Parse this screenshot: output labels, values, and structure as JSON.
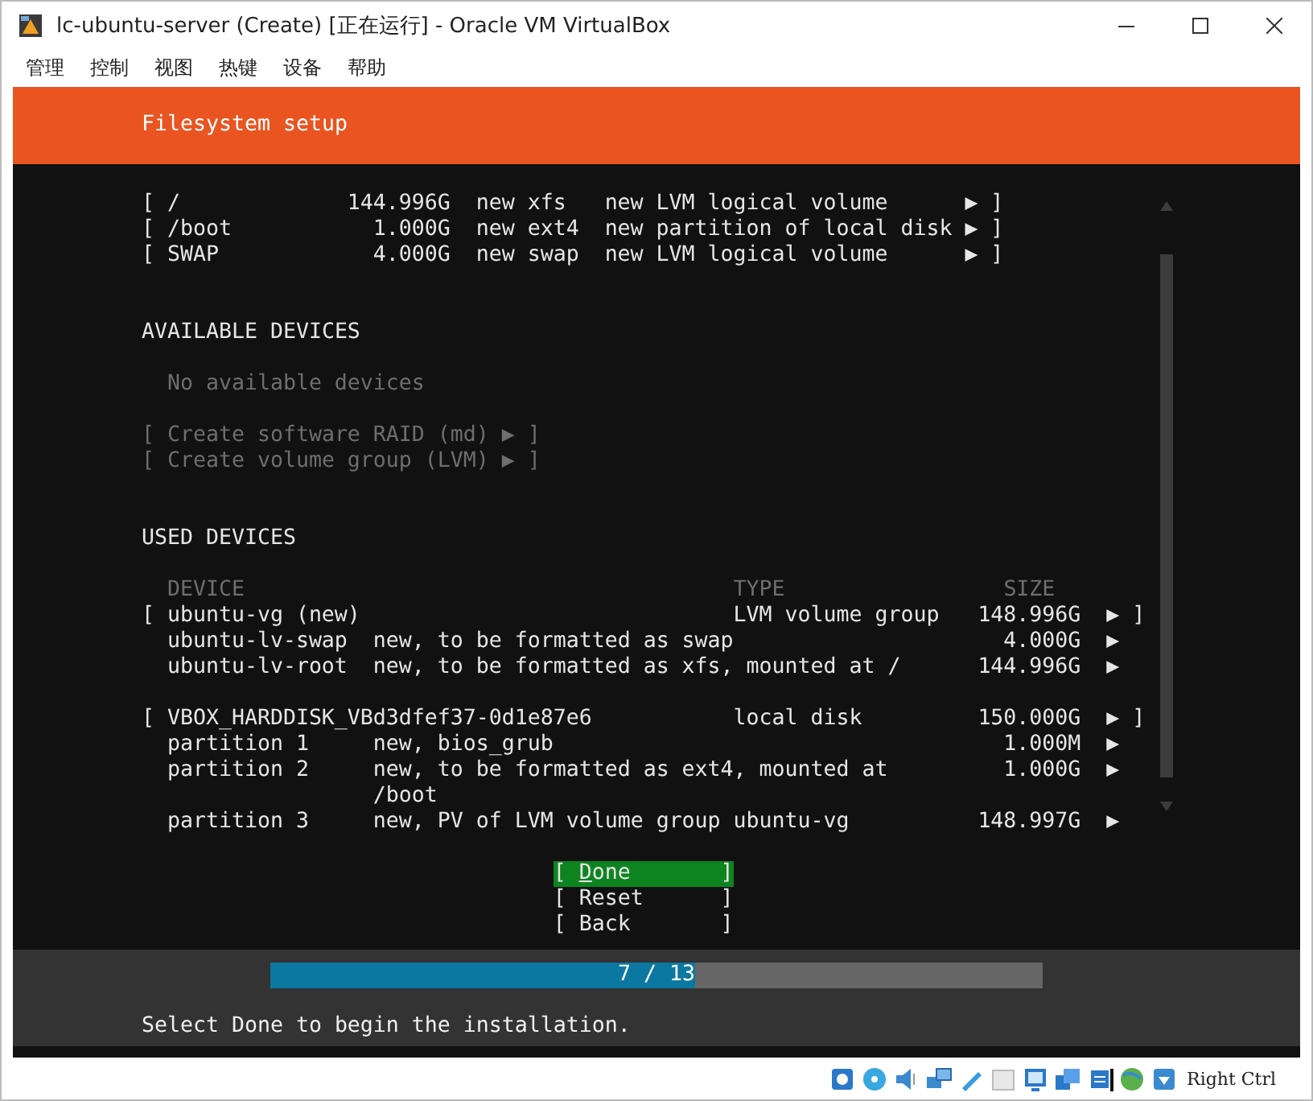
{
  "window": {
    "title": "lc-ubuntu-server (Create) [正在运行] - Oracle VM VirtualBox"
  },
  "menu": [
    "管理",
    "控制",
    "视图",
    "热键",
    "设备",
    "帮助"
  ],
  "header": {
    "title": "Filesystem setup"
  },
  "filesystem_summary": [
    {
      "open": "[",
      "mount": "/",
      "size": "144.996G",
      "format": "new xfs",
      "type": "new LVM logical volume",
      "arrow": "▶",
      "close": "]"
    },
    {
      "open": "[",
      "mount": "/boot",
      "size": "1.000G",
      "format": "new ext4",
      "type": "new partition of local disk",
      "arrow": "▶",
      "close": "]"
    },
    {
      "open": "[",
      "mount": "SWAP",
      "size": "4.000G",
      "format": "new swap",
      "type": "new LVM logical volume",
      "arrow": "▶",
      "close": "]"
    }
  ],
  "available_devices": {
    "heading": "AVAILABLE DEVICES",
    "empty_message": "No available devices",
    "actions": [
      {
        "label": "[ Create software RAID (md) ▶ ]",
        "disabled": true
      },
      {
        "label": "[ Create volume group (LVM) ▶ ]",
        "disabled": true
      }
    ]
  },
  "used_devices": {
    "heading": "USED DEVICES",
    "columns": [
      "DEVICE",
      "TYPE",
      "SIZE"
    ],
    "devices": [
      {
        "open": "[",
        "name": "ubuntu-vg (new)",
        "type": "LVM volume group",
        "size": "148.996G",
        "arrow": "▶",
        "close": "]",
        "children": [
          {
            "name": "ubuntu-lv-swap",
            "description": "new, to be formatted as swap",
            "size": "4.000G",
            "arrow": "▶"
          },
          {
            "name": "ubuntu-lv-root",
            "description": "new, to be formatted as xfs, mounted at /",
            "size": "144.996G",
            "arrow": "▶"
          }
        ]
      },
      {
        "open": "[",
        "name": "VBOX_HARDDISK_VBd3dfef37-0d1e87e6",
        "type": "local disk",
        "size": "150.000G",
        "arrow": "▶",
        "close": "]",
        "children": [
          {
            "name": "partition 1",
            "description": "new, bios_grub",
            "size": "1.000M",
            "arrow": "▶"
          },
          {
            "name": "partition 2",
            "description": "new, to be formatted as ext4, mounted at /boot",
            "size": "1.000G",
            "arrow": "▶"
          },
          {
            "name": "partition 3",
            "description": "new, PV of LVM volume group ubuntu-vg",
            "size": "148.997G",
            "arrow": "▶"
          }
        ]
      }
    ]
  },
  "buttons": [
    {
      "open": "[",
      "label": "Done",
      "close": "]",
      "selected": true
    },
    {
      "open": "[",
      "label": "Reset",
      "close": "]",
      "selected": false
    },
    {
      "open": "[",
      "label": "Back",
      "close": "]",
      "selected": false
    }
  ],
  "progress": {
    "label": "7 / 13",
    "level": 0.55
  },
  "status_message": "Select Done to begin the installation.",
  "status_bar": {
    "host_key": "Right Ctrl"
  }
}
